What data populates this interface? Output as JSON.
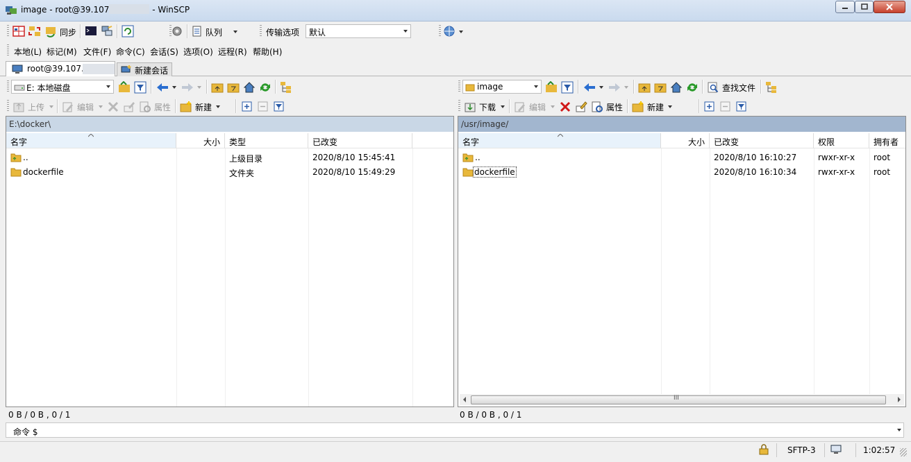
{
  "window": {
    "title": "image - root@39.107",
    "title_suffix": "- WinSCP"
  },
  "toolbar1": {
    "sync_label": "同步",
    "queue_label": "队列",
    "transfer_label": "传输选项",
    "transfer_value": "默认"
  },
  "menu": [
    "本地(L)",
    "标记(M)",
    "文件(F)",
    "命令(C)",
    "会话(S)",
    "选项(O)",
    "远程(R)",
    "帮助(H)"
  ],
  "tabs": {
    "session": "root@39.107.",
    "new_session": "新建会话"
  },
  "left": {
    "drive": "E: 本地磁盘",
    "upload_label": "上传",
    "edit_label": "编辑",
    "props_label": "属性",
    "new_label": "新建",
    "path": "E:\\docker\\",
    "columns": {
      "name": "名字",
      "size": "大小",
      "type": "类型",
      "changed": "已改变"
    },
    "rows": [
      {
        "name": "..",
        "size": "",
        "type": "上级目录",
        "changed": "2020/8/10  15:45:41"
      },
      {
        "name": "dockerfile",
        "size": "",
        "type": "文件夹",
        "changed": "2020/8/10  15:49:29"
      }
    ],
    "status": "0 B / 0 B ,  0 / 1"
  },
  "right": {
    "dir": "image",
    "find_label": "查找文件",
    "download_label": "下载",
    "edit_label": "编辑",
    "props_label": "属性",
    "new_label": "新建",
    "path": "/usr/image/",
    "columns": {
      "name": "名字",
      "size": "大小",
      "changed": "已改变",
      "rights": "权限",
      "owner": "拥有者"
    },
    "rows": [
      {
        "name": "..",
        "size": "",
        "changed": "2020/8/10 16:10:27",
        "rights": "rwxr-xr-x",
        "owner": "root"
      },
      {
        "name": "dockerfile",
        "size": "",
        "changed": "2020/8/10 16:10:34",
        "rights": "rwxr-xr-x",
        "owner": "root"
      }
    ],
    "scroll_grip": "III",
    "status": "0 B / 0 B ,  0 / 1"
  },
  "command": {
    "label": "命令 $",
    "value": ""
  },
  "statusbar": {
    "protocol": "SFTP-3",
    "time": "1:02:57"
  },
  "colors": {
    "active_path": "#a2b6cf",
    "inactive_path": "#c9d7e6",
    "folder": "#e8b83b"
  }
}
